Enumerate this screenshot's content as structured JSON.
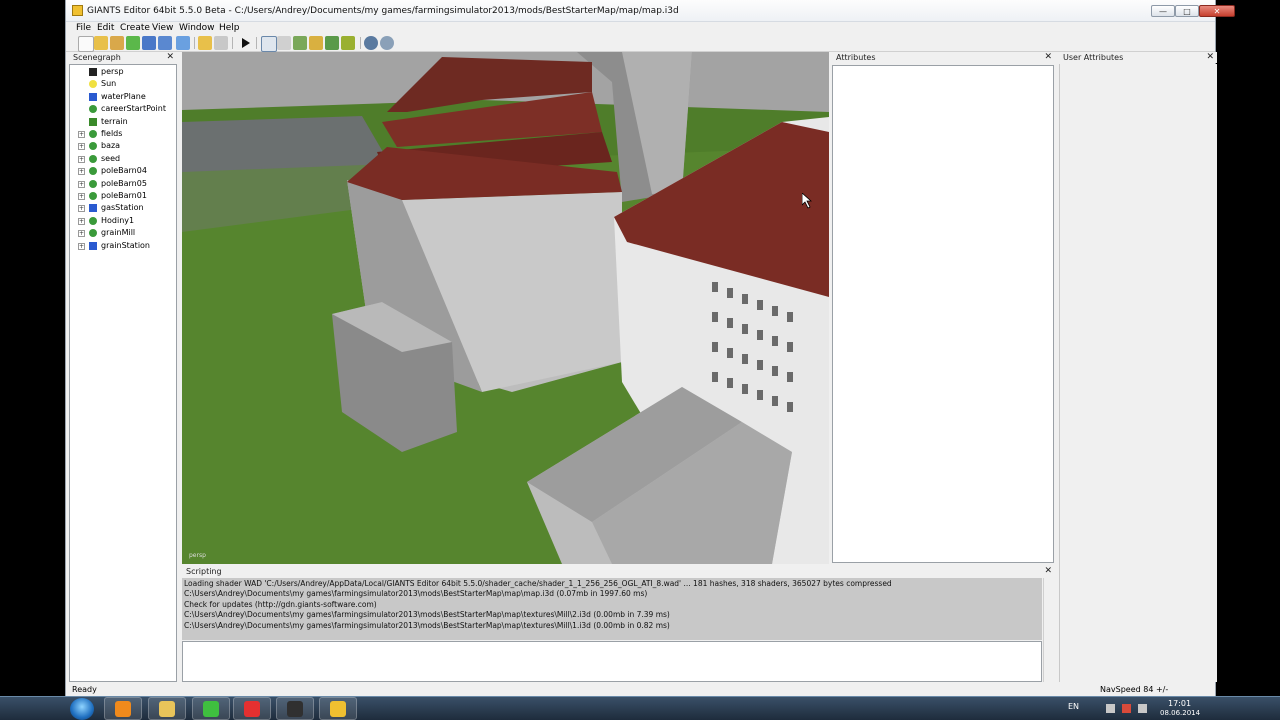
{
  "window": {
    "title": "GIANTS Editor 64bit 5.5.0 Beta - C:/Users/Andrey/Documents/my games/farmingsimulator2013/mods/BestStarterMap/map/map.i3d",
    "controls": {
      "minimize": "—",
      "maximize": "□",
      "close": "✕"
    }
  },
  "menu": [
    "File",
    "Edit",
    "Create",
    "View",
    "Window",
    "Help"
  ],
  "scenegraph": {
    "title": "Scenegraph",
    "nodes": [
      {
        "label": "persp",
        "icon": "camera-icon",
        "expandable": false
      },
      {
        "label": "Sun",
        "icon": "light-icon",
        "expandable": false
      },
      {
        "label": "waterPlane",
        "icon": "shape-icon",
        "expandable": false
      },
      {
        "label": "careerStartPoint",
        "icon": "transform-icon",
        "expandable": false
      },
      {
        "label": "terrain",
        "icon": "terrain-icon",
        "expandable": false
      },
      {
        "label": "fields",
        "icon": "transform-icon",
        "expandable": true
      },
      {
        "label": "baza",
        "icon": "transform-icon",
        "expandable": true
      },
      {
        "label": "seed",
        "icon": "transform-icon",
        "expandable": true
      },
      {
        "label": "poleBarn04",
        "icon": "transform-icon",
        "expandable": true
      },
      {
        "label": "poleBarn05",
        "icon": "transform-icon",
        "expandable": true
      },
      {
        "label": "poleBarn01",
        "icon": "transform-icon",
        "expandable": true
      },
      {
        "label": "gasStation",
        "icon": "shape-icon",
        "expandable": true
      },
      {
        "label": "Hodiny1",
        "icon": "transform-icon",
        "expandable": true
      },
      {
        "label": "grainMill",
        "icon": "transform-icon",
        "expandable": true
      },
      {
        "label": "grainStation",
        "icon": "shape-icon",
        "expandable": true
      }
    ]
  },
  "viewport": {
    "camera_label": "persp"
  },
  "attributes": {
    "title": "Attributes"
  },
  "user_attributes": {
    "title": "User Attributes"
  },
  "scripting": {
    "title": "Scripting",
    "lines": [
      "Loading shader WAD 'C:/Users/Andrey/AppData/Local/GIANTS Editor 64bit 5.5.0/shader_cache/shader_1_1_256_256_OGL_ATI_8.wad' ... 181 hashes, 318 shaders, 365027 bytes compressed",
      "C:\\Users\\Andrey\\Documents\\my games\\farmingsimulator2013\\mods\\BestStarterMap\\map\\map.i3d (0.07mb in 1997.60 ms)",
      "Check for updates (http://gdn.giants-software.com)",
      "C:\\Users\\Andrey\\Documents\\my games\\farmingsimulator2013\\mods\\BestStarterMap\\map\\textures\\Mill\\2.i3d (0.00mb in 7.39 ms)",
      "C:\\Users\\Andrey\\Documents\\my games\\farmingsimulator2013\\mods\\BestStarterMap\\map\\textures\\Mill\\1.i3d (0.00mb in 0.82 ms)"
    ]
  },
  "status": {
    "left": "Ready",
    "right": "NavSpeed 84 +/-"
  },
  "taskbar": {
    "lang": "EN",
    "time": "17:01",
    "date": "08.06.2014",
    "apps": [
      {
        "name": "media-player-icon",
        "color": "#f08a1c"
      },
      {
        "name": "explorer-icon",
        "color": "#e8c45a"
      },
      {
        "name": "icq-icon",
        "color": "#3fbf3f"
      },
      {
        "name": "yandex-browser-icon",
        "color": "#e53030"
      },
      {
        "name": "obs-icon",
        "color": "#303030"
      },
      {
        "name": "giants-editor-icon",
        "color": "#f0c030"
      }
    ]
  }
}
